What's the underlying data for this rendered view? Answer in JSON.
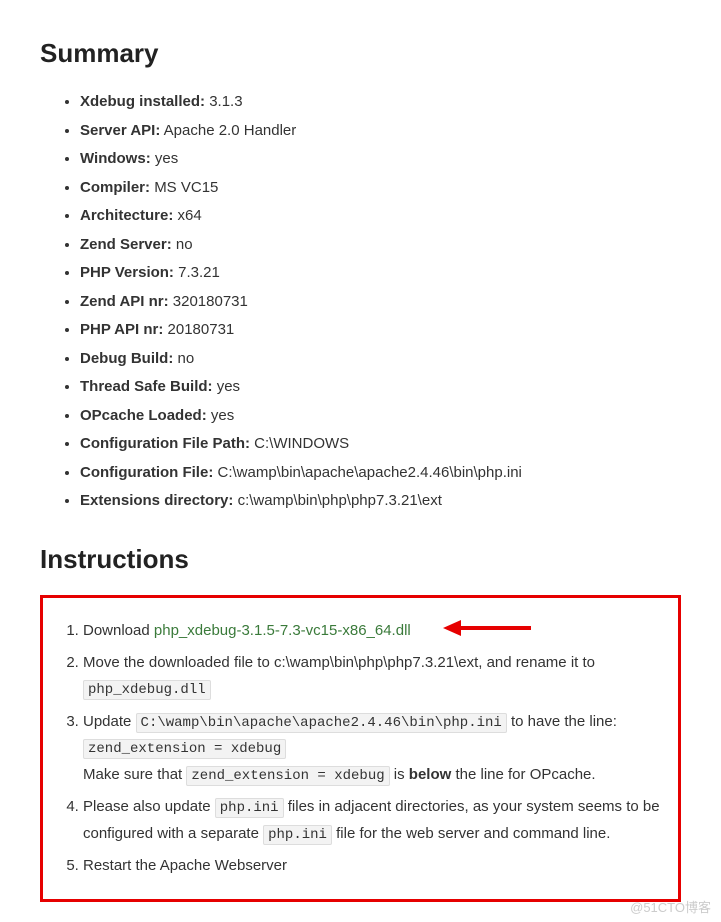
{
  "summary": {
    "heading": "Summary",
    "items": [
      {
        "label": "Xdebug installed:",
        "value": "3.1.3"
      },
      {
        "label": "Server API:",
        "value": "Apache 2.0 Handler"
      },
      {
        "label": "Windows:",
        "value": "yes"
      },
      {
        "label": "Compiler:",
        "value": "MS VC15"
      },
      {
        "label": "Architecture:",
        "value": "x64"
      },
      {
        "label": "Zend Server:",
        "value": "no"
      },
      {
        "label": "PHP Version:",
        "value": "7.3.21"
      },
      {
        "label": "Zend API nr:",
        "value": "320180731"
      },
      {
        "label": "PHP API nr:",
        "value": "20180731"
      },
      {
        "label": "Debug Build:",
        "value": "no"
      },
      {
        "label": "Thread Safe Build:",
        "value": "yes"
      },
      {
        "label": "OPcache Loaded:",
        "value": "yes"
      },
      {
        "label": "Configuration File Path:",
        "value": "C:\\WINDOWS"
      },
      {
        "label": "Configuration File:",
        "value": "C:\\wamp\\bin\\apache\\apache2.4.46\\bin\\php.ini"
      },
      {
        "label": "Extensions directory:",
        "value": "c:\\wamp\\bin\\php\\php7.3.21\\ext"
      }
    ]
  },
  "instructions": {
    "heading": "Instructions",
    "step1": {
      "prefix": "Download ",
      "link": "php_xdebug-3.1.5-7.3-vc15-x86_64.dll"
    },
    "step2": {
      "text_a": "Move the downloaded file to c:\\wamp\\bin\\php\\php7.3.21\\ext, and rename it to ",
      "code_a": "php_xdebug.dll"
    },
    "step3": {
      "text_a": "Update ",
      "code_a": "C:\\wamp\\bin\\apache\\apache2.4.46\\bin\\php.ini",
      "text_b": " to have the line:",
      "code_b": "zend_extension = xdebug",
      "text_c": "Make sure that ",
      "code_c": "zend_extension = xdebug",
      "text_d": " is ",
      "bold": "below",
      "text_e": " the line for OPcache."
    },
    "step4": {
      "text_a": "Please also update ",
      "code_a": "php.ini",
      "text_b": " files in adjacent directories, as your system seems to be configured with a separate ",
      "code_b": "php.ini",
      "text_c": " file for the web server and command line."
    },
    "step5": {
      "text": "Restart the Apache Webserver"
    }
  },
  "watermark": "@51CTO博客"
}
